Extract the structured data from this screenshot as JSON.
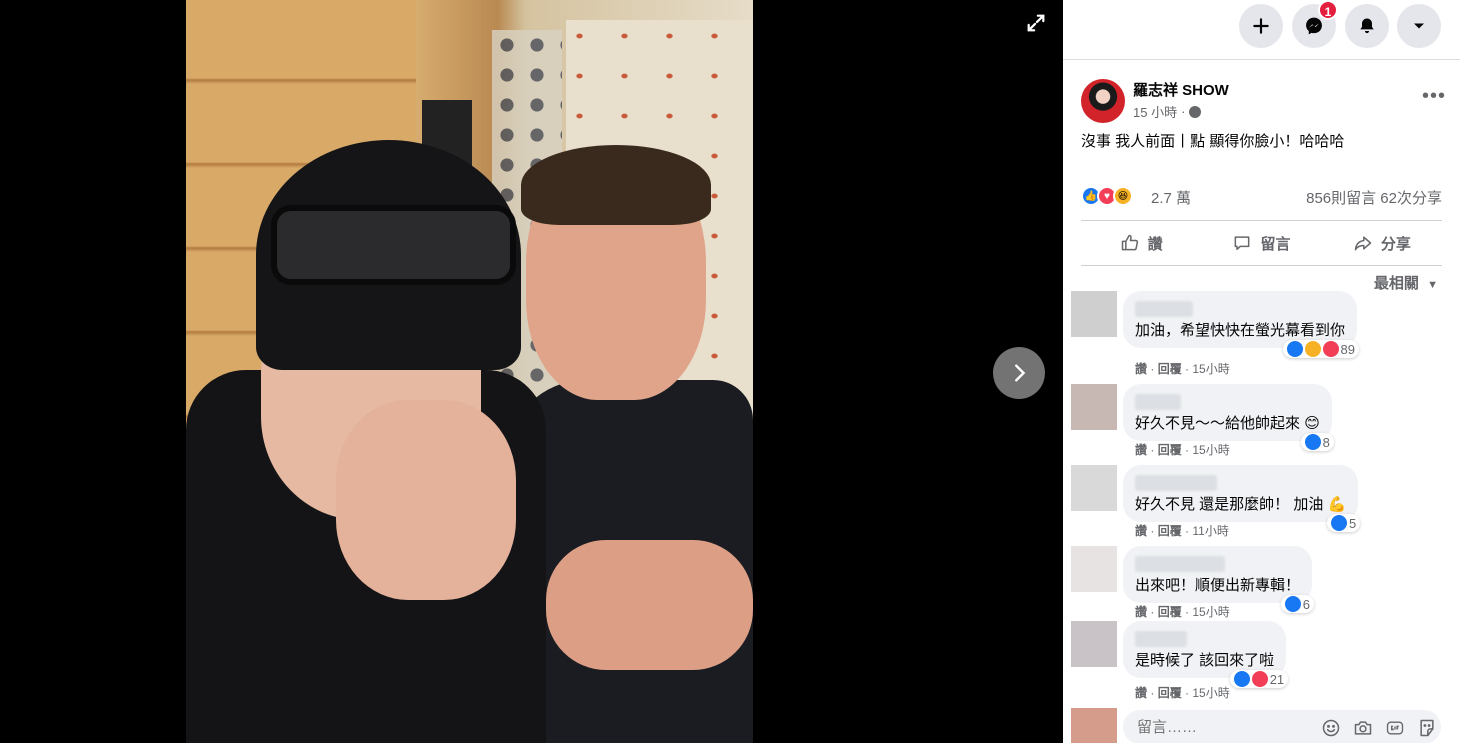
{
  "viewer": {
    "expand_icon": "expand-icon",
    "next_icon": "chevron-right-icon"
  },
  "topbar": {
    "create_icon": "plus-icon",
    "messenger_icon": "messenger-icon",
    "messenger_badge": "1",
    "notifications_icon": "bell-icon",
    "account_icon": "caret-down-icon"
  },
  "post": {
    "author": "羅志祥 SHOW",
    "time": "15 小時",
    "privacy_icon": "globe-icon",
    "text": "沒事 我人前面丨點 顯得你臉小！哈哈哈",
    "reaction_count": "2.7 萬",
    "counts": "856則留言  62次分享",
    "more_icon": "more-icon"
  },
  "actions": {
    "like": "讚",
    "comment": "留言",
    "share": "分享"
  },
  "sort_label": "最相關",
  "comments": [
    {
      "text": "加油，希望快快在螢光幕看到你",
      "react_count": "89",
      "like_label": "讚",
      "reply_label": "回覆",
      "time": "15小時"
    },
    {
      "text": "好久不見～～給他帥起來",
      "react_count": "8",
      "like_label": "讚",
      "reply_label": "回覆",
      "time": "15小時"
    },
    {
      "text": "好久不見 還是那麼帥！ 加油",
      "react_count": "5",
      "like_label": "讚",
      "reply_label": "回覆",
      "time": "11小時"
    },
    {
      "text": "出來吧！順便出新專輯！",
      "react_count": "6",
      "like_label": "讚",
      "reply_label": "回覆",
      "time": "15小時"
    },
    {
      "text": "是時候了 該回來了啦",
      "react_count": "21",
      "like_label": "讚",
      "reply_label": "回覆",
      "time": "15小時"
    }
  ],
  "composer": {
    "placeholder": "留言……"
  },
  "colors": {
    "accent": "#1877f2",
    "love": "#f33e58",
    "haha": "#f7b125",
    "badge": "#e41e3f"
  }
}
